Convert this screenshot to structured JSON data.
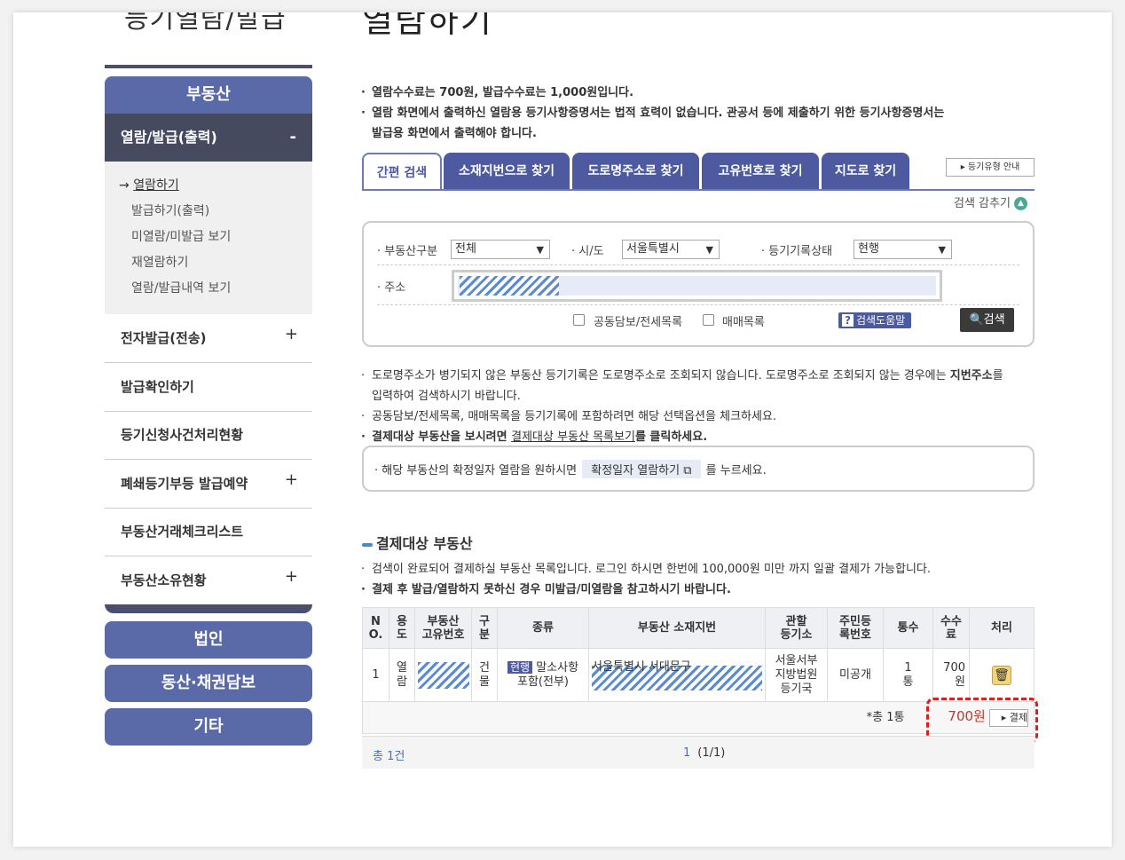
{
  "left_title": "등기열람/발급",
  "main_title": "열람하기",
  "sidebar": {
    "category_top": "부동산",
    "active_item": {
      "label": "열람/발급(출력)",
      "toggle": "-"
    },
    "sub_items": [
      {
        "label": "열람하기",
        "arrow": "→"
      },
      {
        "label": "발급하기(출력)"
      },
      {
        "label": "미열람/미발급 보기"
      },
      {
        "label": "재열람하기"
      },
      {
        "label": "열람/발급내역 보기"
      }
    ],
    "items": [
      {
        "label": "전자발급(전송)",
        "toggle": "+"
      },
      {
        "label": "발급확인하기",
        "toggle": ""
      },
      {
        "label": "등기신청사건처리현황",
        "toggle": ""
      },
      {
        "label": "폐쇄등기부등 발급예약",
        "toggle": "+"
      },
      {
        "label": "부동산거래체크리스트",
        "toggle": ""
      },
      {
        "label": "부동산소유현황",
        "toggle": "+"
      }
    ],
    "categories": [
      "법인",
      "동산·채권담보",
      "기타"
    ]
  },
  "notices_top": [
    "열람수수료는 700원, 발급수수료는 1,000원입니다.",
    "열람 화면에서 출력하신 열람용 등기사항증명서는 법적 효력이 없습니다. 관공서 등에 제출하기 위한 등기사항증명서는",
    "발급용 화면에서 출력해야 합니다."
  ],
  "tabs": [
    "간편 검색",
    "소재지번으로 찾기",
    "도로명주소로 찾기",
    "고유번호로 찾기",
    "지도로 찾기"
  ],
  "help_link": "등기유형 안내",
  "collapse_label": "검색 감추기",
  "search": {
    "type_label": "부동산구분",
    "type_value": "전체",
    "city_label": "시/도",
    "city_value": "서울특별시",
    "status_label": "등기기록상태",
    "status_value": "현행",
    "address_label": "주소",
    "check1": "공동담보/전세목록",
    "check2": "매매목록",
    "help_label": "검색도움말",
    "search_button": "검색"
  },
  "notices_mid": {
    "line1": "도로명주소가 병기되지 않은 부동산 등기기록은 도로명주소로 조회되지 않습니다. 도로명주소로 조회되지 않는 경우에는 ",
    "line1_bold": "지번주소",
    "line1_end": "를",
    "line2": "입력하여 검색하시기 바랍니다.",
    "line3": "공동담보/전세목록, 매매목록을 등기기록에 포함하려면 해당 선택옵션을 체크하세요.",
    "line4_a": "결제대상 부동산을 보시려면 ",
    "line4_link": "결제대상 부동산 목록보기",
    "line4_b": "를 클릭하세요."
  },
  "confirm": {
    "before": "해당 부동산의 확정일자 열람을 원하시면",
    "button": "확정일자 열람하기",
    "after": "를 누르세요."
  },
  "section_title": "결제대상 부동산",
  "notices_bottom": [
    "검색이 완료되어 결제하실 부동산 목록입니다. 로그인 하시면 한번에 100,000원 미만 까지 일괄 결제가 가능합니다.",
    "결제 후 발급/열람하지 못하신 경우 미발급/미열람을 참고하시기 바랍니다."
  ],
  "table": {
    "headers": [
      "N\nO.",
      "용\n도",
      "부동산\n고유번호",
      "구\n분",
      "종류",
      "부동산 소재지번",
      "관할\n등기소",
      "주민등\n록번호",
      "통수",
      "수수\n료",
      "처리"
    ],
    "row": {
      "no": "1",
      "usage": "열\n람",
      "kind": "건\n물",
      "type_tag": "현행",
      "type_text": "말소사항",
      "type_text2": "포함(전부)",
      "address": "서울특별시 서대문구",
      "office": "서울서부\n지방법원\n등기국",
      "resident": "미공개",
      "count": "1\n통",
      "fee": "700\n원"
    },
    "total_label": "*총 1통",
    "total_fee": "700원",
    "pay_button": "결제"
  },
  "footer": {
    "total": "총 1건",
    "page_current": "1",
    "page_info": "(1/1)"
  },
  "colors": {
    "accent": "#4d5aa0",
    "sidebar_dark": "#464a5e",
    "highlight": "#e21b1b"
  }
}
